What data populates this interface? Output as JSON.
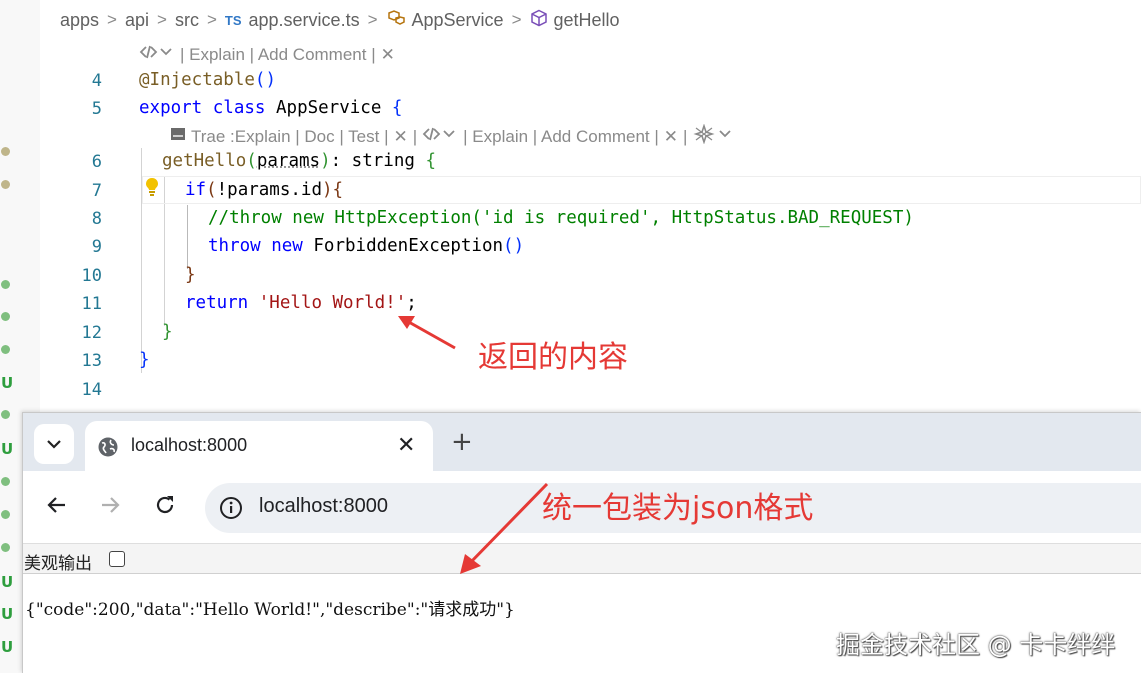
{
  "breadcrumb": {
    "items": [
      "apps",
      "api",
      "src"
    ],
    "file_badge": "TS",
    "file": "app.service.ts",
    "class_name": "AppService",
    "method_name": "getHello",
    "separator": ">"
  },
  "codelens_top": {
    "explain": "| Explain | Add Comment |",
    "close": "✕"
  },
  "codelens_method": {
    "trae": "Trae :Explain | Doc | Test |",
    "explain": "| Explain | Add Comment |",
    "close": "✕",
    "pipe": "|"
  },
  "code_lines": {
    "l4": {
      "num": "4"
    },
    "l5": {
      "num": "5"
    },
    "l6": {
      "num": "6"
    },
    "l7": {
      "num": "7"
    },
    "l8": {
      "num": "8"
    },
    "l9": {
      "num": "9"
    },
    "l10": {
      "num": "10"
    },
    "l11": {
      "num": "11"
    },
    "l12": {
      "num": "12"
    },
    "l13": {
      "num": "13"
    },
    "l14": {
      "num": "14"
    }
  },
  "code_tokens": {
    "decorator": "@Injectable",
    "export": "export",
    "class": "class",
    "classname": "AppService",
    "method": "getHello",
    "param": "params",
    "rettype": ": string",
    "if": "if",
    "cond": "!params.id",
    "comment": "//throw new HttpException('id is required', HttpStatus.BAD_REQUEST)",
    "throw": "throw",
    "new": "new",
    "exc": "ForbiddenException",
    "return": "return",
    "retval": "'Hello World!'"
  },
  "annotations": {
    "return_content": "返回的内容",
    "json_wrap": "统一包装为json格式"
  },
  "browser": {
    "tab_title": "localhost:8000",
    "tab_close": "✕",
    "new_tab": "+",
    "address": "localhost:8000",
    "pretty_print_label": "美观输出",
    "pretty_print_checked": false,
    "json_response": "{\"code\":200,\"data\":\"Hello World!\",\"describe\":\"请求成功\"}"
  },
  "side_markers": {
    "u": "U"
  },
  "watermark": "掘金技术社区 @ 卡卡绊绊",
  "colors": {
    "keyword": "#0000ff",
    "string": "#a31515",
    "comment": "#008000",
    "function": "#795e26",
    "line_number": "#237893",
    "annotation": "#e53935",
    "git_added": "#2e9e3e"
  }
}
